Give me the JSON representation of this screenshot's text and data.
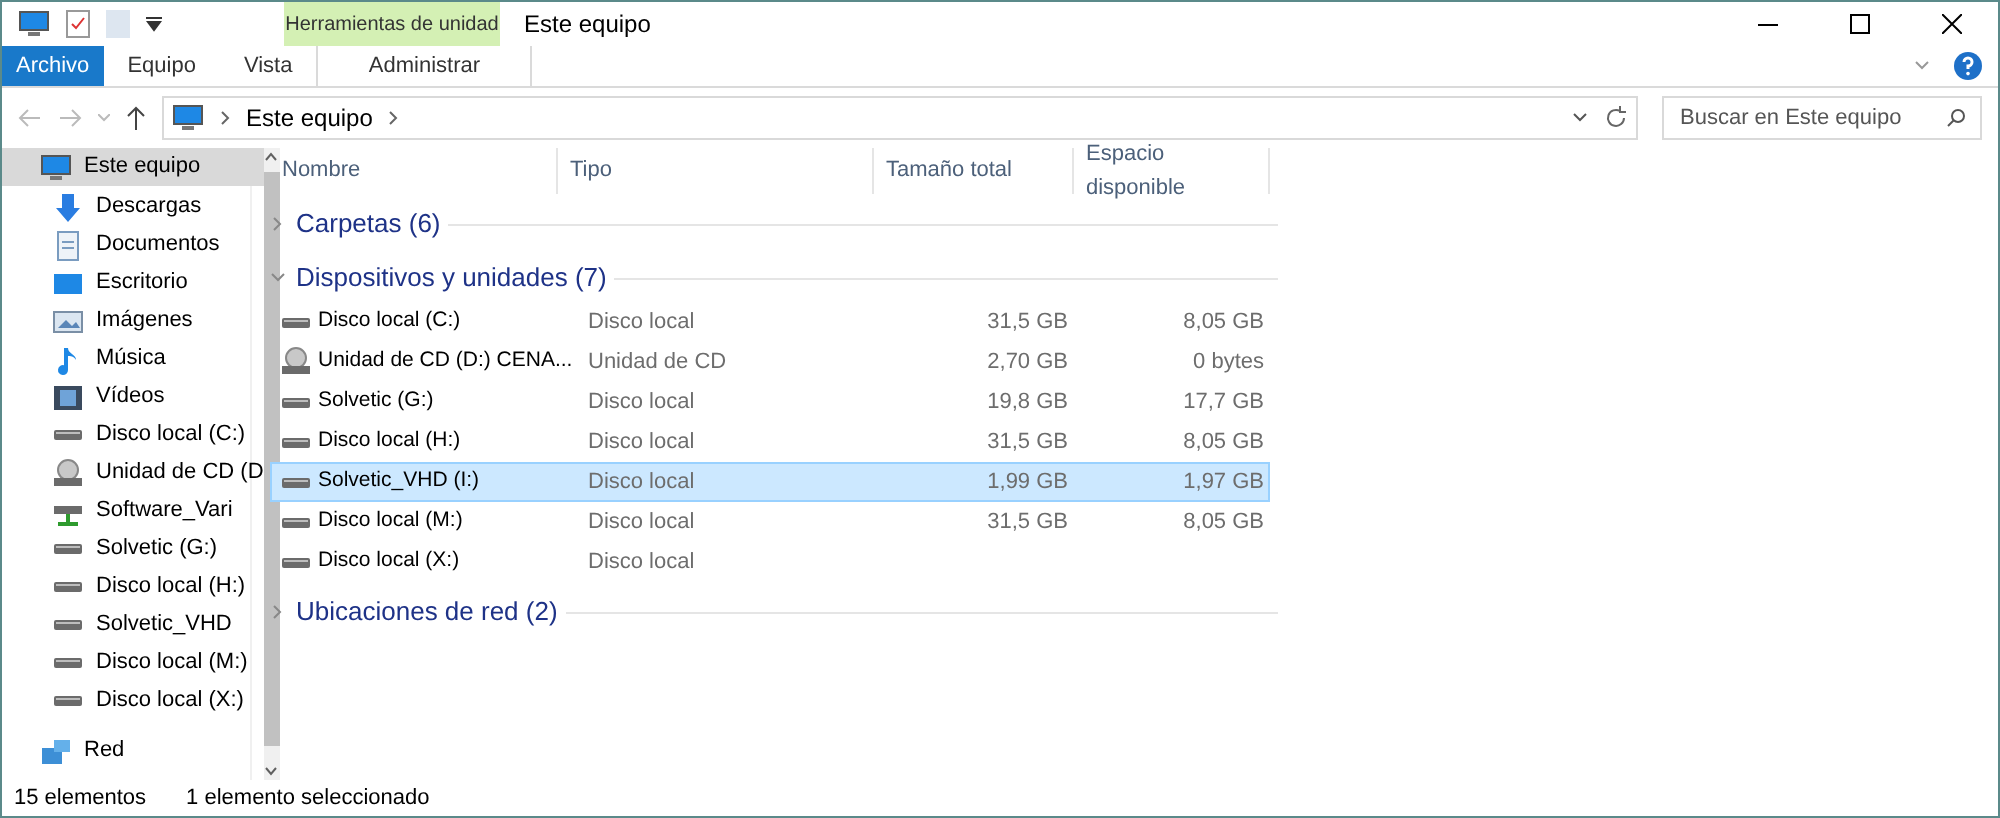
{
  "window": {
    "title": "Este equipo"
  },
  "quick_access": {
    "context_tab": "Herramientas de unidad"
  },
  "ribbon_tabs": [
    {
      "label": "Archivo",
      "kind": "file",
      "selected": false
    },
    {
      "label": "Equipo",
      "kind": "tab",
      "selected": false
    },
    {
      "label": "Vista",
      "kind": "tab",
      "selected": false
    },
    {
      "label": "Administrar",
      "kind": "context",
      "selected": false
    }
  ],
  "address": {
    "path": [
      "Este equipo"
    ]
  },
  "search": {
    "placeholder": "Buscar en Este equipo"
  },
  "sidebar": {
    "items": [
      {
        "label": "Este equipo",
        "kind": "pc",
        "selected": true
      },
      {
        "label": "Descargas",
        "kind": "download",
        "selected": false
      },
      {
        "label": "Documentos",
        "kind": "documents",
        "selected": false
      },
      {
        "label": "Escritorio",
        "kind": "desktop",
        "selected": false
      },
      {
        "label": "Imágenes",
        "kind": "images",
        "selected": false
      },
      {
        "label": "Música",
        "kind": "music",
        "selected": false
      },
      {
        "label": "Vídeos",
        "kind": "videos",
        "selected": false
      },
      {
        "label": "Disco local (C:)",
        "kind": "drive",
        "selected": false
      },
      {
        "label": "Unidad de CD (D",
        "kind": "cd",
        "selected": false
      },
      {
        "label": "Software_Vari",
        "kind": "netdrive",
        "selected": false
      },
      {
        "label": "Solvetic (G:)",
        "kind": "drive",
        "selected": false
      },
      {
        "label": "Disco local (H:)",
        "kind": "drive",
        "selected": false
      },
      {
        "label": "Solvetic_VHD",
        "kind": "drive",
        "selected": false
      },
      {
        "label": "Disco local (M:)",
        "kind": "drive",
        "selected": false
      },
      {
        "label": "Disco local (X:)",
        "kind": "drive",
        "selected": false
      },
      {
        "label": "Red",
        "kind": "network",
        "selected": false
      }
    ]
  },
  "table": {
    "columns": [
      "Nombre",
      "Tipo",
      "Tamaño total",
      "Espacio disponible"
    ],
    "groups": [
      {
        "title": "Carpetas (6)",
        "expanded": false
      },
      {
        "title": "Dispositivos y unidades (7)",
        "expanded": true,
        "rows": [
          {
            "name": "Disco local (C:)",
            "kind": "drive",
            "type": "Disco local",
            "total": "31,5 GB",
            "free": "8,05 GB",
            "selected": false
          },
          {
            "name": "Unidad de CD (D:) CENA...",
            "kind": "cd",
            "type": "Unidad de CD",
            "total": "2,70 GB",
            "free": "0 bytes",
            "selected": false
          },
          {
            "name": "Solvetic (G:)",
            "kind": "drive",
            "type": "Disco local",
            "total": "19,8 GB",
            "free": "17,7 GB",
            "selected": false
          },
          {
            "name": "Disco local (H:)",
            "kind": "drive",
            "type": "Disco local",
            "total": "31,5 GB",
            "free": "8,05 GB",
            "selected": false
          },
          {
            "name": "Solvetic_VHD (I:)",
            "kind": "drive",
            "type": "Disco local",
            "total": "1,99 GB",
            "free": "1,97 GB",
            "selected": true
          },
          {
            "name": "Disco local (M:)",
            "kind": "drive",
            "type": "Disco local",
            "total": "31,5 GB",
            "free": "8,05 GB",
            "selected": false
          },
          {
            "name": "Disco local (X:)",
            "kind": "drive",
            "type": "Disco local",
            "selected": false
          }
        ]
      },
      {
        "title": "Ubicaciones de red (2)",
        "expanded": false
      }
    ]
  },
  "status_bar": {
    "count": "15 elementos",
    "selection": "1 elemento seleccionado"
  }
}
